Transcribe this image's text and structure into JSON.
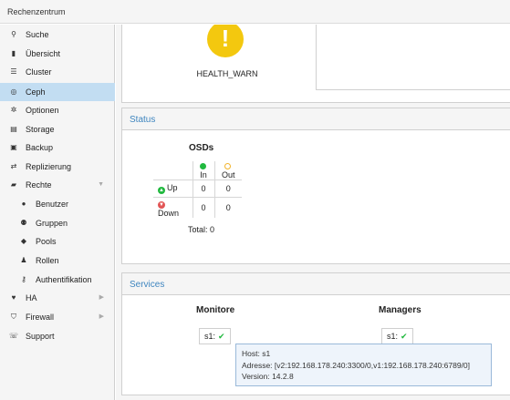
{
  "window": {
    "title": "Rechenzentrum"
  },
  "sidebar": {
    "items": [
      {
        "label": "Suche",
        "icon": "search-icon",
        "glyph": "⚲"
      },
      {
        "label": "Übersicht",
        "icon": "book-icon",
        "glyph": "▮"
      },
      {
        "label": "Cluster",
        "icon": "server-list-icon",
        "glyph": "☰"
      },
      {
        "label": "Ceph",
        "icon": "ceph-icon",
        "glyph": "◎"
      },
      {
        "label": "Optionen",
        "icon": "gear-icon",
        "glyph": "✲"
      },
      {
        "label": "Storage",
        "icon": "database-icon",
        "glyph": "▤"
      },
      {
        "label": "Backup",
        "icon": "floppy-icon",
        "glyph": "▣"
      },
      {
        "label": "Replizierung",
        "icon": "retweet-icon",
        "glyph": "⇄"
      },
      {
        "label": "Rechte",
        "icon": "unlock-icon",
        "glyph": "▰"
      },
      {
        "label": "Benutzer",
        "icon": "user-icon",
        "glyph": "●"
      },
      {
        "label": "Gruppen",
        "icon": "users-icon",
        "glyph": "⚉"
      },
      {
        "label": "Pools",
        "icon": "tags-icon",
        "glyph": "◆"
      },
      {
        "label": "Rollen",
        "icon": "male-icon",
        "glyph": "♟"
      },
      {
        "label": "Authentifikation",
        "icon": "key-icon",
        "glyph": "⚷"
      },
      {
        "label": "HA",
        "icon": "heartbeat-icon",
        "glyph": "♥"
      },
      {
        "label": "Firewall",
        "icon": "shield-icon",
        "glyph": "⛉"
      },
      {
        "label": "Support",
        "icon": "comments-icon",
        "glyph": "☏"
      }
    ]
  },
  "health": {
    "status": "HEALTH_WARN",
    "icon": "exclamation-icon",
    "color": "#f3c80f"
  },
  "status_panel": {
    "title": "Status",
    "osds": {
      "title": "OSDs",
      "col_in": "In",
      "col_out": "Out",
      "rows": [
        {
          "label": "Up",
          "in": "0",
          "out": "0"
        },
        {
          "label": "Down",
          "in": "0",
          "out": "0"
        }
      ],
      "total": "Total: 0"
    }
  },
  "services_panel": {
    "title": "Services",
    "monitors": {
      "title": "Monitore",
      "chip": "s1:"
    },
    "managers": {
      "title": "Managers",
      "chip": "s1:"
    }
  },
  "tooltip": {
    "host": "Host: s1",
    "address": "Adresse: [v2:192.168.178.240:3300/0,v1:192.168.178.240:6789/0]",
    "version": "Version: 14.2.8"
  },
  "colors": {
    "accent": "#3e85bf",
    "ok": "#21b93f",
    "warn": "#f3c80f",
    "error": "#e25555",
    "selected": "#c2ddf2"
  }
}
